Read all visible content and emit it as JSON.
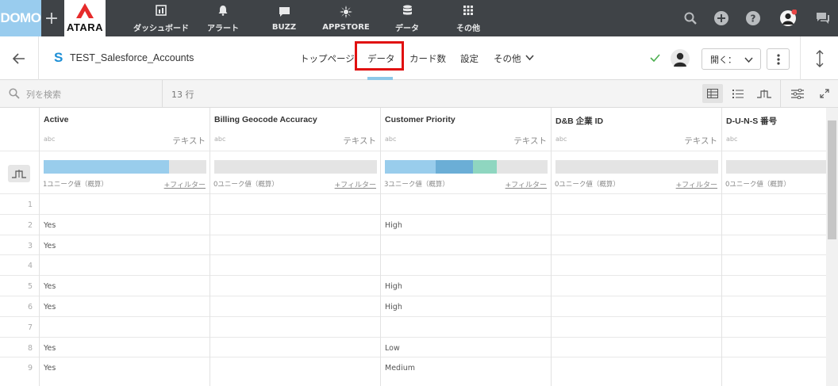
{
  "topnav": {
    "logo": "DOMO",
    "plus": "+",
    "company": "ATARA",
    "items": [
      {
        "label": "ダッシュボード",
        "icon": "dashboard-icon"
      },
      {
        "label": "アラート",
        "icon": "bell-icon"
      },
      {
        "label": "BUZZ",
        "icon": "chat-icon"
      },
      {
        "label": "APPSTORE",
        "icon": "appstore-icon"
      },
      {
        "label": "データ",
        "icon": "database-icon"
      },
      {
        "label": "その他",
        "icon": "grid-icon"
      }
    ]
  },
  "subheader": {
    "dataset_title": "TEST_Salesforce_Accounts",
    "connector_letter": "S",
    "tabs": [
      "トップページ",
      "データ",
      "カード数",
      "設定",
      "その他"
    ],
    "active_tab": "データ",
    "open_button": "開く："
  },
  "toolbar": {
    "search_placeholder": "列を検索",
    "row_count": "13 行"
  },
  "columns": [
    {
      "name": "Active",
      "type": "テキスト",
      "abc": "abc",
      "unique": "1ユニーク値（概算）",
      "filter": "+フィルター",
      "bar": [
        {
          "fraction": 0.77,
          "color": "#99cdec"
        }
      ]
    },
    {
      "name": "Billing Geocode Accuracy",
      "type": "テキスト",
      "abc": "abc",
      "unique": "0ユニーク値（概算）",
      "filter": "+フィルター",
      "bar": []
    },
    {
      "name": "Customer Priority",
      "type": "テキスト",
      "abc": "abc",
      "unique": "3ユニーク値（概算）",
      "filter": "+フィルター",
      "bar": [
        {
          "fraction": 0.31,
          "color": "#99cdec"
        },
        {
          "fraction": 0.23,
          "color": "#6baed6"
        },
        {
          "fraction": 0.15,
          "color": "#8fd6c0"
        }
      ]
    },
    {
      "name": "D&B 企業 ID",
      "type": "テキスト",
      "abc": "abc",
      "unique": "0ユニーク値（概算）",
      "filter": "+フィルター",
      "bar": []
    },
    {
      "name": "D-U-N-S 番号",
      "type": "",
      "abc": "abc",
      "unique": "0ユニーク値（概算）",
      "filter": "",
      "bar": []
    }
  ],
  "rows": [
    {
      "n": "1",
      "cells": [
        "",
        "",
        "",
        "",
        ""
      ]
    },
    {
      "n": "2",
      "cells": [
        "Yes",
        "",
        "High",
        "",
        ""
      ]
    },
    {
      "n": "3",
      "cells": [
        "Yes",
        "",
        "",
        "",
        ""
      ]
    },
    {
      "n": "4",
      "cells": [
        "",
        "",
        "",
        "",
        ""
      ]
    },
    {
      "n": "5",
      "cells": [
        "Yes",
        "",
        "High",
        "",
        ""
      ]
    },
    {
      "n": "6",
      "cells": [
        "Yes",
        "",
        "High",
        "",
        ""
      ]
    },
    {
      "n": "7",
      "cells": [
        "",
        "",
        "",
        "",
        ""
      ]
    },
    {
      "n": "8",
      "cells": [
        "Yes",
        "",
        "Low",
        "",
        ""
      ]
    },
    {
      "n": "9",
      "cells": [
        "Yes",
        "",
        "Medium",
        "",
        ""
      ]
    }
  ],
  "colors": {
    "nav_bg": "#3f4347",
    "domo_blue": "#99ccee",
    "highlight_red": "#e01010",
    "accent_blue": "#8cc8e8"
  }
}
